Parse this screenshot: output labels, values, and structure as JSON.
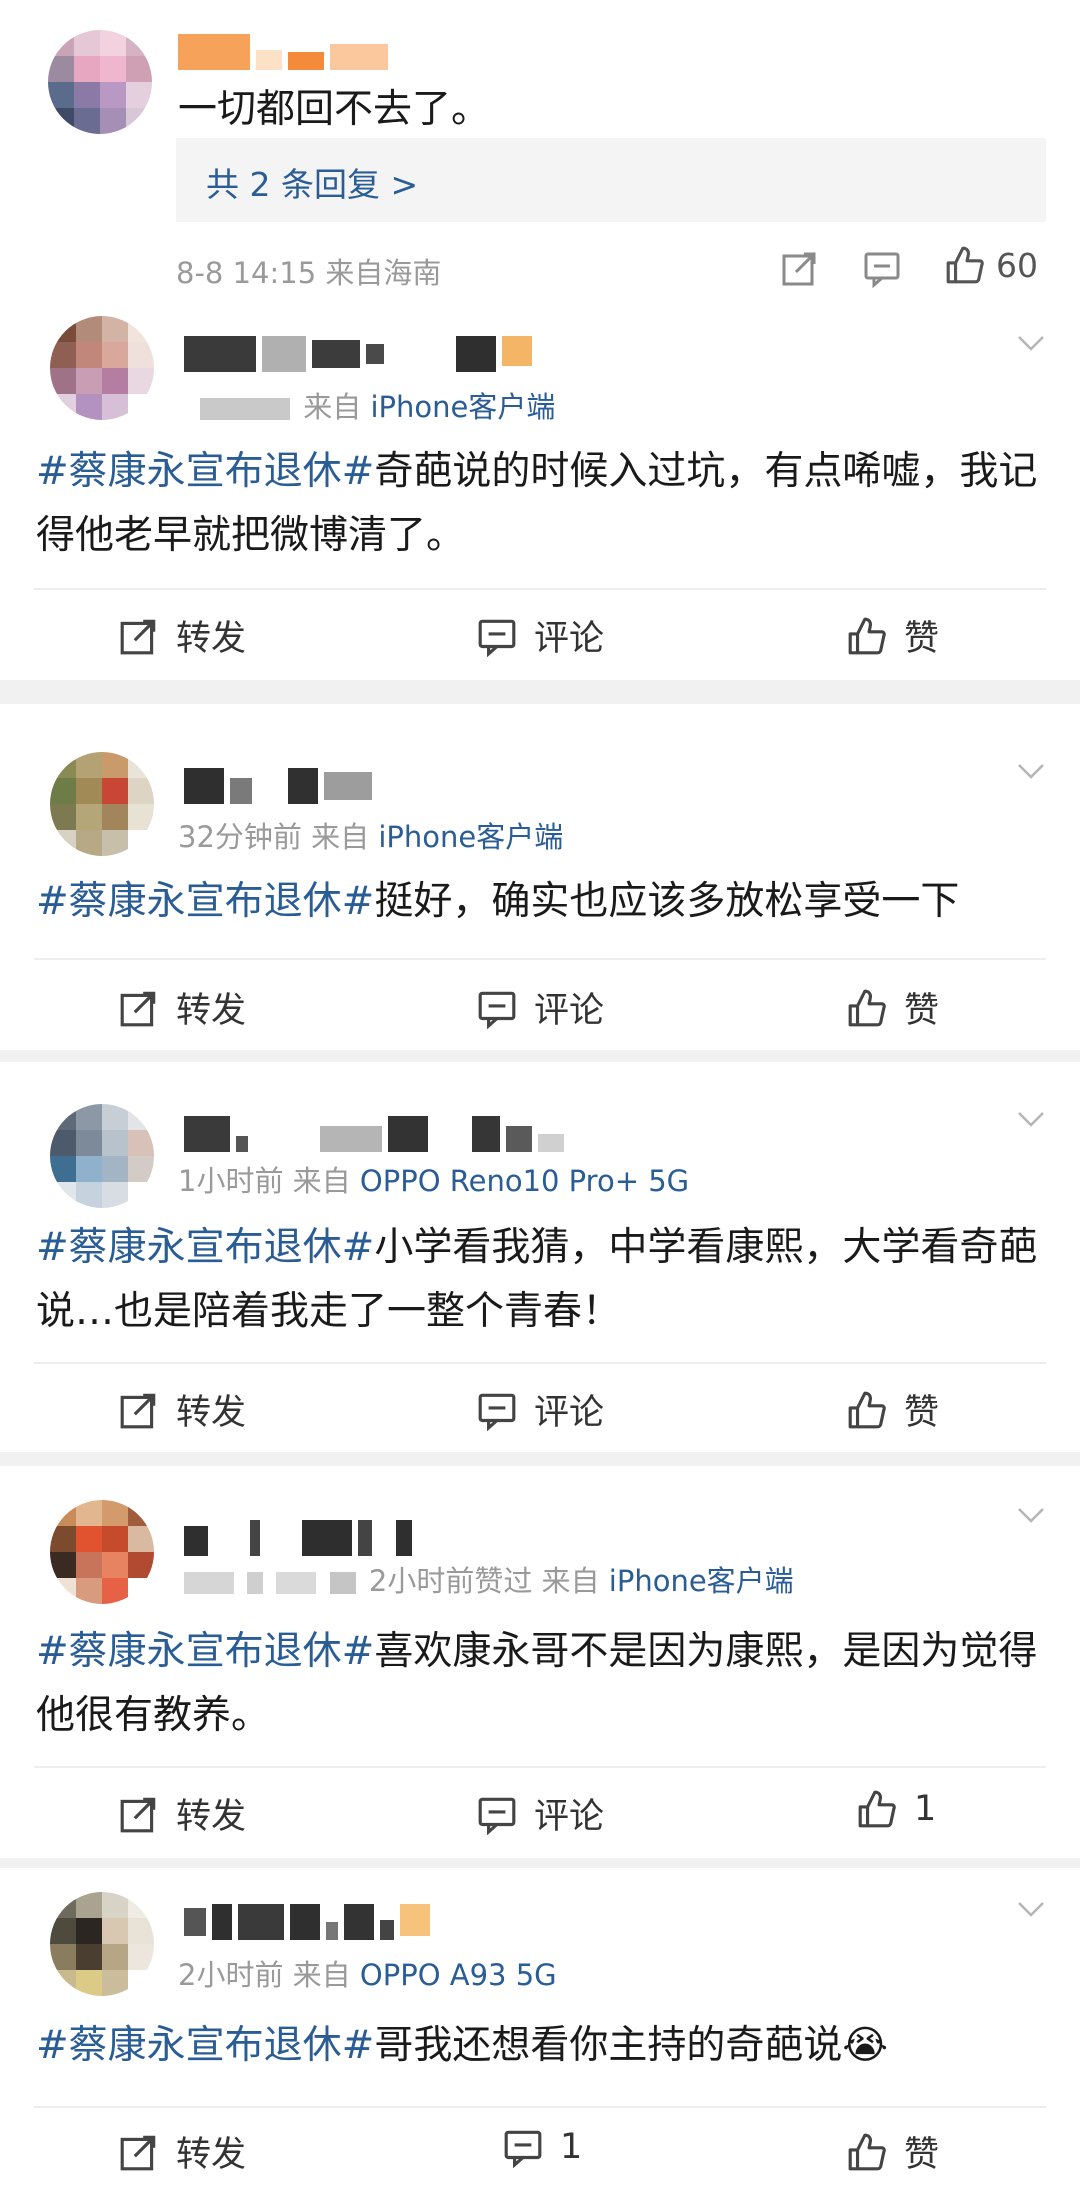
{
  "reply": {
    "text": "一切都回不去了。",
    "replies_link": "共 2 条回复 >",
    "meta": "8-8 14:15  来自海南",
    "like_count": "60"
  },
  "posts": [
    {
      "meta_time": "",
      "meta_from": "来自",
      "meta_source": "iPhone客户端",
      "topic": "#蔡康永宣布退休#",
      "text": "奇葩说的时候入过坑，有点唏嘘，我记得他老早就把微博清了。",
      "repost": "转发",
      "comment": "评论",
      "like": "赞"
    },
    {
      "meta_time": "32分钟前",
      "meta_from": "来自",
      "meta_source": "iPhone客户端",
      "topic": "#蔡康永宣布退休#",
      "text": "挺好，确实也应该多放松享受一下",
      "repost": "转发",
      "comment": "评论",
      "like": "赞"
    },
    {
      "meta_time": "1小时前",
      "meta_from": "来自",
      "meta_source": "OPPO Reno10 Pro+ 5G",
      "topic": "#蔡康永宣布退休#",
      "text": "小学看我猜，中学看康熙，大学看奇葩说…也是陪着我走了一整个青春！",
      "repost": "转发",
      "comment": "评论",
      "like": "赞"
    },
    {
      "meta_time": "2小时前赞过",
      "meta_from": "来自",
      "meta_source": "iPhone客户端",
      "topic": "#蔡康永宣布退休#",
      "text": "喜欢康永哥不是因为康熙，是因为觉得他很有教养。",
      "repost": "转发",
      "comment": "评论",
      "like": "1"
    },
    {
      "meta_time": "2小时前",
      "meta_from": "来自",
      "meta_source": "OPPO A93 5G",
      "topic": "#蔡康永宣布退休#",
      "text": "哥我还想看你主持的奇葩说😭",
      "repost": "转发",
      "comment": "1",
      "like": "赞"
    }
  ]
}
